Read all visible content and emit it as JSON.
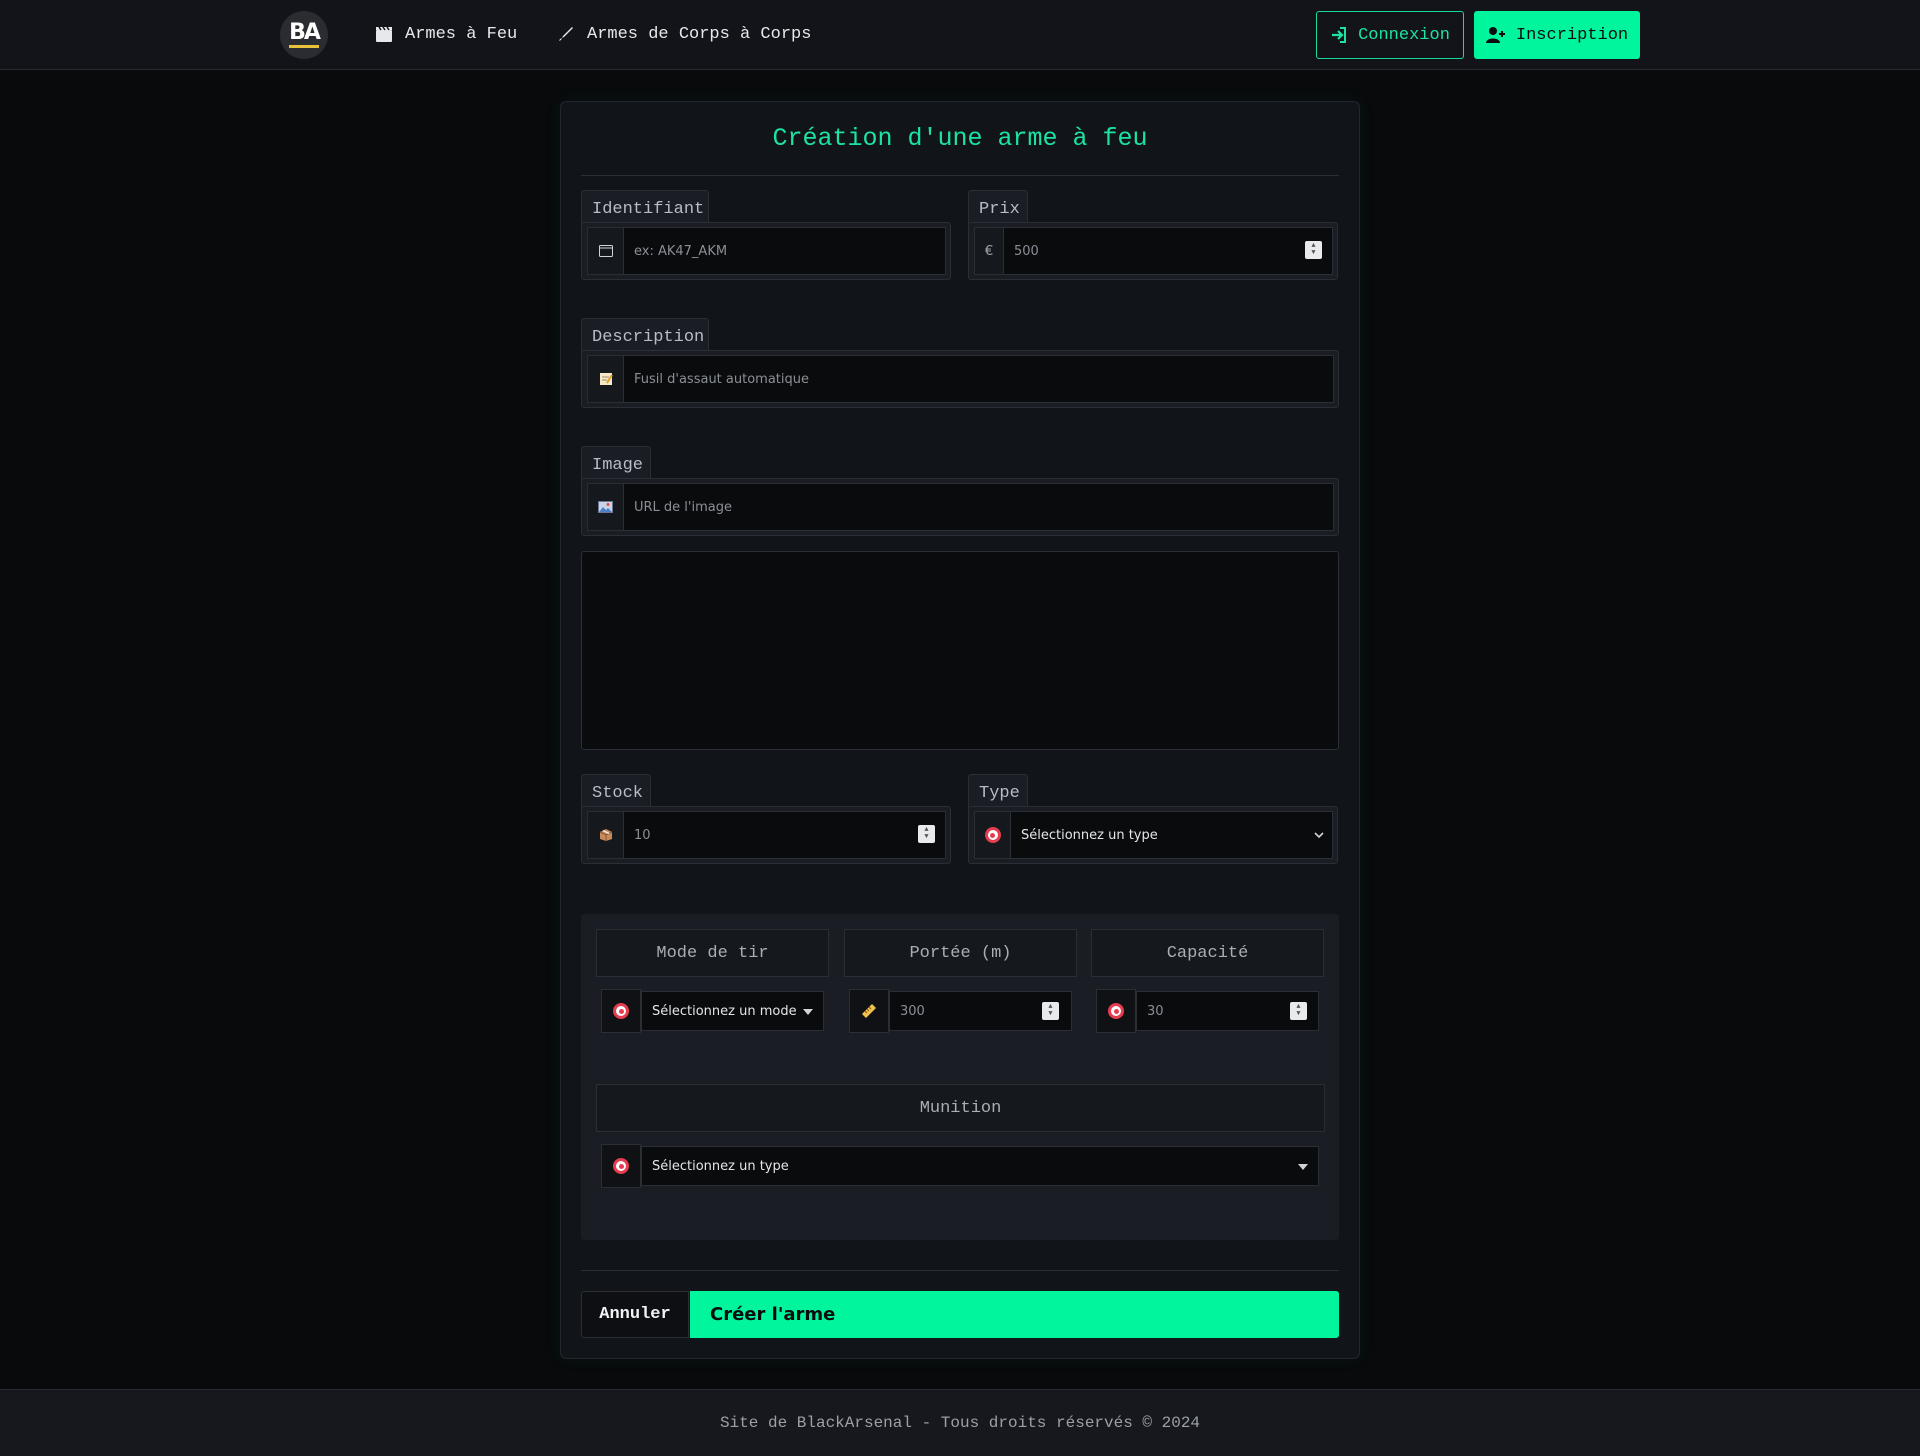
{
  "nav": {
    "logo_text": "BA",
    "links": [
      {
        "label": "Armes à Feu",
        "icon": "clapper-icon"
      },
      {
        "label": "Armes de Corps à Corps",
        "icon": "knife-icon"
      }
    ],
    "login_label": "Connexion",
    "register_label": "Inscription"
  },
  "form": {
    "title": "Création d'une arme à feu",
    "identifiant": {
      "label": "Identifiant",
      "placeholder": "ex: AK47_AKM",
      "icon": "id-card-icon"
    },
    "prix": {
      "label": "Prix",
      "placeholder": "500",
      "addon": "€"
    },
    "description": {
      "label": "Description",
      "placeholder": "Fusil d'assaut automatique",
      "icon": "memo-icon"
    },
    "image": {
      "label": "Image",
      "placeholder": "URL de l'image",
      "icon": "picture-icon"
    },
    "stock": {
      "label": "Stock",
      "placeholder": "10",
      "icon": "package-icon"
    },
    "type": {
      "label": "Type",
      "selected": "Sélectionnez un type",
      "icon": "target-icon"
    },
    "mode_tir": {
      "label": "Mode de tir",
      "selected": "Sélectionnez un mode",
      "icon": "target-icon"
    },
    "portee": {
      "label": "Portée (m)",
      "placeholder": "300",
      "icon": "ruler-icon"
    },
    "capacite": {
      "label": "Capacité",
      "placeholder": "30",
      "icon": "target-icon"
    },
    "munition": {
      "label": "Munition",
      "selected": "Sélectionnez un type",
      "icon": "target-icon"
    },
    "cancel_label": "Annuler",
    "submit_label": "Créer l'arme"
  },
  "footer": {
    "text": "Site de BlackArsenal - Tous droits réservés © 2024"
  },
  "colors": {
    "accent": "#00f59d",
    "background": "#080a0b",
    "card": "#111418"
  }
}
